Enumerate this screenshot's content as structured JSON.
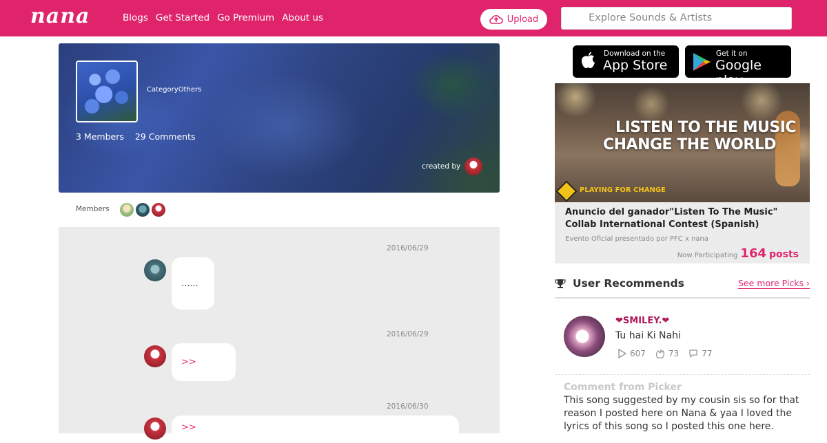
{
  "header": {
    "logo": "nana",
    "nav": [
      "Blogs",
      "Get Started",
      "Go Premium",
      "About us"
    ],
    "upload_label": "Upload",
    "search_placeholder": "Explore Sounds & Artists",
    "brand_color": "#e0246c"
  },
  "group": {
    "category_label": "Category",
    "category_value": "Others",
    "members_count": "3 Members",
    "comments_count": "29 Comments",
    "created_by_label": "created by",
    "members_label": "Members"
  },
  "messages": [
    {
      "date": "2016/06/29",
      "text": "......",
      "avatar": "user-gray"
    },
    {
      "date": "2016/06/29",
      "text": ">>",
      "avatar": "user-red"
    },
    {
      "date": "2016/06/30",
      "text": ">>",
      "avatar": "user-red"
    }
  ],
  "store_badges": {
    "apple_small": "Download on the",
    "apple_big": "App Store",
    "google_small": "Get it on",
    "google_big": "Google play"
  },
  "banner": {
    "line1": "LISTEN TO THE MUSIC",
    "line2": "CHANGE THE WORLD",
    "brand": "PLAYING FOR CHANGE"
  },
  "contest": {
    "title": "Anuncio del ganador\"Listen To The Music\" Collab International Contest  (Spanish)",
    "subtitle": "Evento Oficial presentado por PFC x nana",
    "participating_label": "Now Participating",
    "posts_count": "164",
    "posts_unit": "posts"
  },
  "recommends": {
    "title": "User Recommends",
    "see_more": "See more Picks",
    "user": "❤SMILEY.❤",
    "song": "Tu hai Ki Nahi",
    "plays": "607",
    "applause": "73",
    "comments": "77",
    "picker_label": "Comment from Picker",
    "picker_comment": "This song suggested by my cousin sis so for that reason I posted here on Nana & yaa I loved the lyrics of this song so I posted this one here."
  }
}
